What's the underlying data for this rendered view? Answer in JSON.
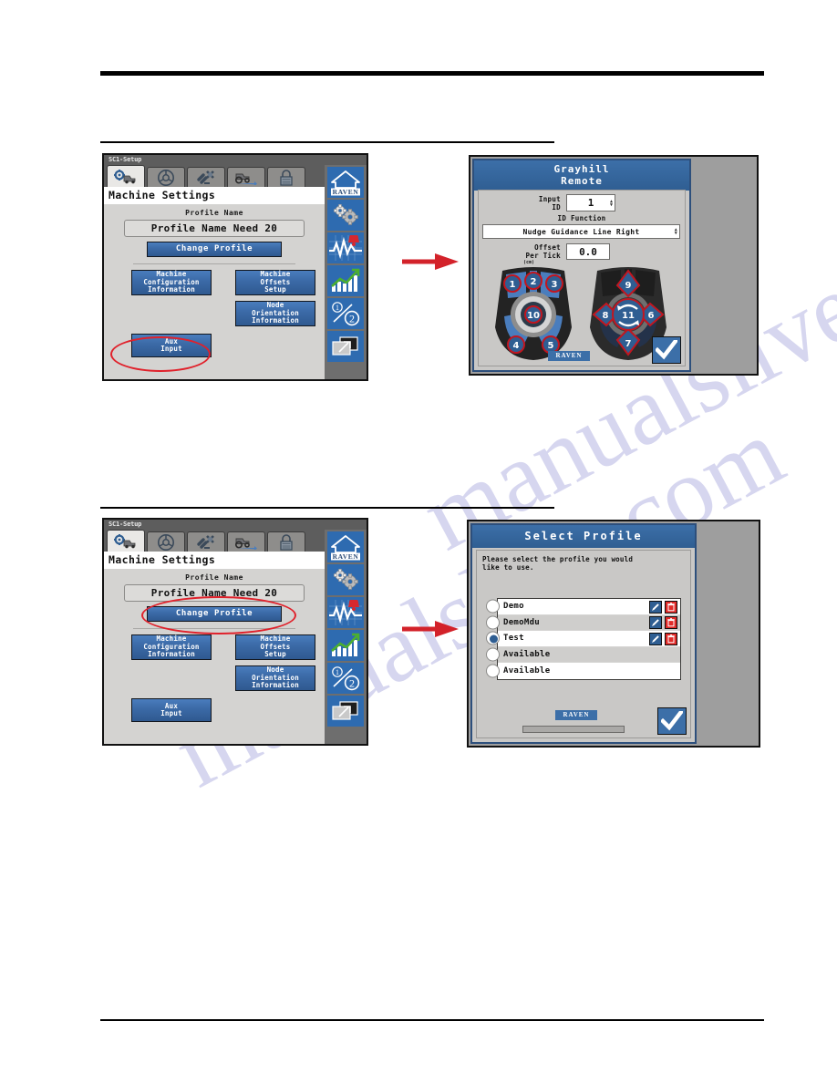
{
  "page": {
    "watermark_text": "manualslive.com"
  },
  "figures": [
    {
      "id": "fig-aux-input",
      "terminal": {
        "titlebar": "SC1-Setup",
        "header": "Machine Settings",
        "tabs": [
          {
            "name": "machine-setup-tab",
            "icon": "gear-truck-icon",
            "active": true
          },
          {
            "name": "steering-tab",
            "icon": "steering-wheel-icon",
            "active": false
          },
          {
            "name": "gps-tab",
            "icon": "satellite-icon",
            "active": false
          },
          {
            "name": "implement-tab",
            "icon": "tractor-icon",
            "active": false
          },
          {
            "name": "lock-tab",
            "icon": "lock-icon",
            "active": false
          }
        ],
        "profile_label": "Profile Name",
        "profile_value": "Profile Name Need 20",
        "change_profile_label": "Change Profile",
        "buttons": [
          {
            "name": "machine-configuration-information-button",
            "label": "Machine\nConfiguration\nInformation"
          },
          {
            "name": "machine-offsets-setup-button",
            "label": "Machine\nOffsets\nSetup"
          },
          {
            "name": "node-orientation-information-button",
            "label": "Node\nOrientation\nInformation"
          },
          {
            "name": "aux-input-button",
            "label": "Aux\nInput"
          }
        ],
        "sidebar": [
          {
            "name": "home-icon",
            "label": "RAVEN"
          },
          {
            "name": "settings-gears-icon",
            "label": ""
          },
          {
            "name": "diagnostics-waveform-alarm-icon",
            "label": ""
          },
          {
            "name": "performance-chart-icon",
            "label": ""
          },
          {
            "name": "screen-fraction-icon",
            "label": "1/2"
          },
          {
            "name": "window-swap-icon",
            "label": ""
          }
        ],
        "highlight": "aux-input-button"
      },
      "dialog": {
        "type": "grayhill-remote",
        "title_line1": "Grayhill",
        "title_line2": "Remote",
        "fields": [
          {
            "name": "input-id-field",
            "label": "Input\nID",
            "value": "1"
          },
          {
            "name": "id-function-field",
            "label": "ID Function",
            "value": "Nudge Guidance Line Right"
          },
          {
            "name": "offset-per-tick-field",
            "label": "Offset\nPer Tick",
            "unit": "(cm)",
            "value": "0.0"
          }
        ],
        "remote_left_buttons": [
          "1",
          "2",
          "3",
          "10",
          "4",
          "5"
        ],
        "remote_right_buttons": [
          "9",
          "8",
          "11",
          "6",
          "7"
        ],
        "brand": "RAVEN",
        "accept_icon": "checkmark-icon"
      }
    },
    {
      "id": "fig-change-profile",
      "terminal": {
        "titlebar": "SC1-Setup",
        "header": "Machine Settings",
        "tabs": [
          {
            "name": "machine-setup-tab",
            "icon": "gear-truck-icon",
            "active": true
          },
          {
            "name": "steering-tab",
            "icon": "steering-wheel-icon",
            "active": false
          },
          {
            "name": "gps-tab",
            "icon": "satellite-icon",
            "active": false
          },
          {
            "name": "implement-tab",
            "icon": "tractor-icon",
            "active": false
          },
          {
            "name": "lock-tab",
            "icon": "lock-icon",
            "active": false
          }
        ],
        "profile_label": "Profile Name",
        "profile_value": "Profile Name Need 20",
        "change_profile_label": "Change Profile",
        "buttons": [
          {
            "name": "machine-configuration-information-button",
            "label": "Machine\nConfiguration\nInformation"
          },
          {
            "name": "machine-offsets-setup-button",
            "label": "Machine\nOffsets\nSetup"
          },
          {
            "name": "node-orientation-information-button",
            "label": "Node\nOrientation\nInformation"
          },
          {
            "name": "aux-input-button",
            "label": "Aux\nInput"
          }
        ],
        "highlight": "change-profile-button"
      },
      "dialog": {
        "type": "select-profile",
        "title": "Select Profile",
        "message": "Please select the profile you would\nlike to use.",
        "profiles": [
          {
            "name": "Demo",
            "selected": false,
            "has_actions": true
          },
          {
            "name": "DemoMdu",
            "selected": false,
            "has_actions": true
          },
          {
            "name": "Test",
            "selected": true,
            "has_actions": true
          },
          {
            "name": "Available",
            "selected": false,
            "has_actions": false
          },
          {
            "name": "Available",
            "selected": false,
            "has_actions": false
          }
        ],
        "brand": "RAVEN",
        "accept_icon": "checkmark-icon",
        "edit_icon": "pencil-icon",
        "delete_icon": "trash-icon"
      }
    }
  ],
  "colors": {
    "accent_blue": "#3c6fa8",
    "highlight_red": "#e0212b",
    "panel_gray": "#c9c8c6",
    "chrome_gray": "#6e6e6e",
    "delete_red": "#e02a28"
  }
}
